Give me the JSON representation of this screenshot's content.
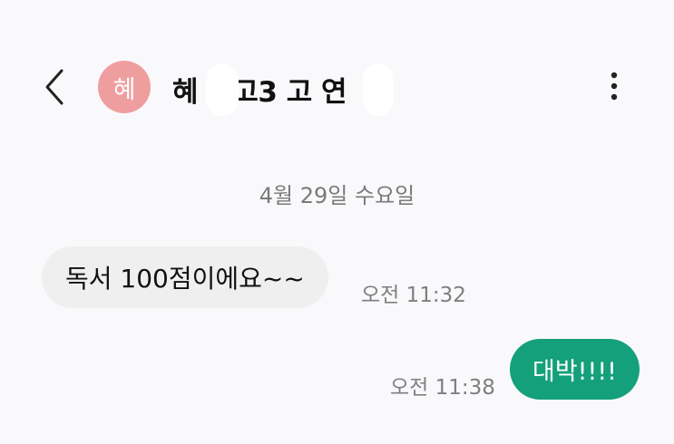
{
  "header": {
    "back_icon": "chevron-left-icon",
    "avatar_initial": "혜",
    "avatar_color": "#ef9ea0",
    "contact_name": "혜 여고3 고 연",
    "expand_icon": "chevron-down-icon",
    "more_icon": "more-vertical-icon"
  },
  "conversation": {
    "date_separator": "4월 29일 수요일",
    "messages": [
      {
        "direction": "incoming",
        "text": "독서 100점이에요~~",
        "time": "오전 11:32"
      },
      {
        "direction": "outgoing",
        "text": "대박!!!!",
        "time": "오전 11:38"
      }
    ]
  },
  "colors": {
    "background": "#f9f9fc",
    "incoming_bubble": "#efefef",
    "outgoing_bubble": "#14a07a",
    "timestamp": "#7f7f7f"
  }
}
